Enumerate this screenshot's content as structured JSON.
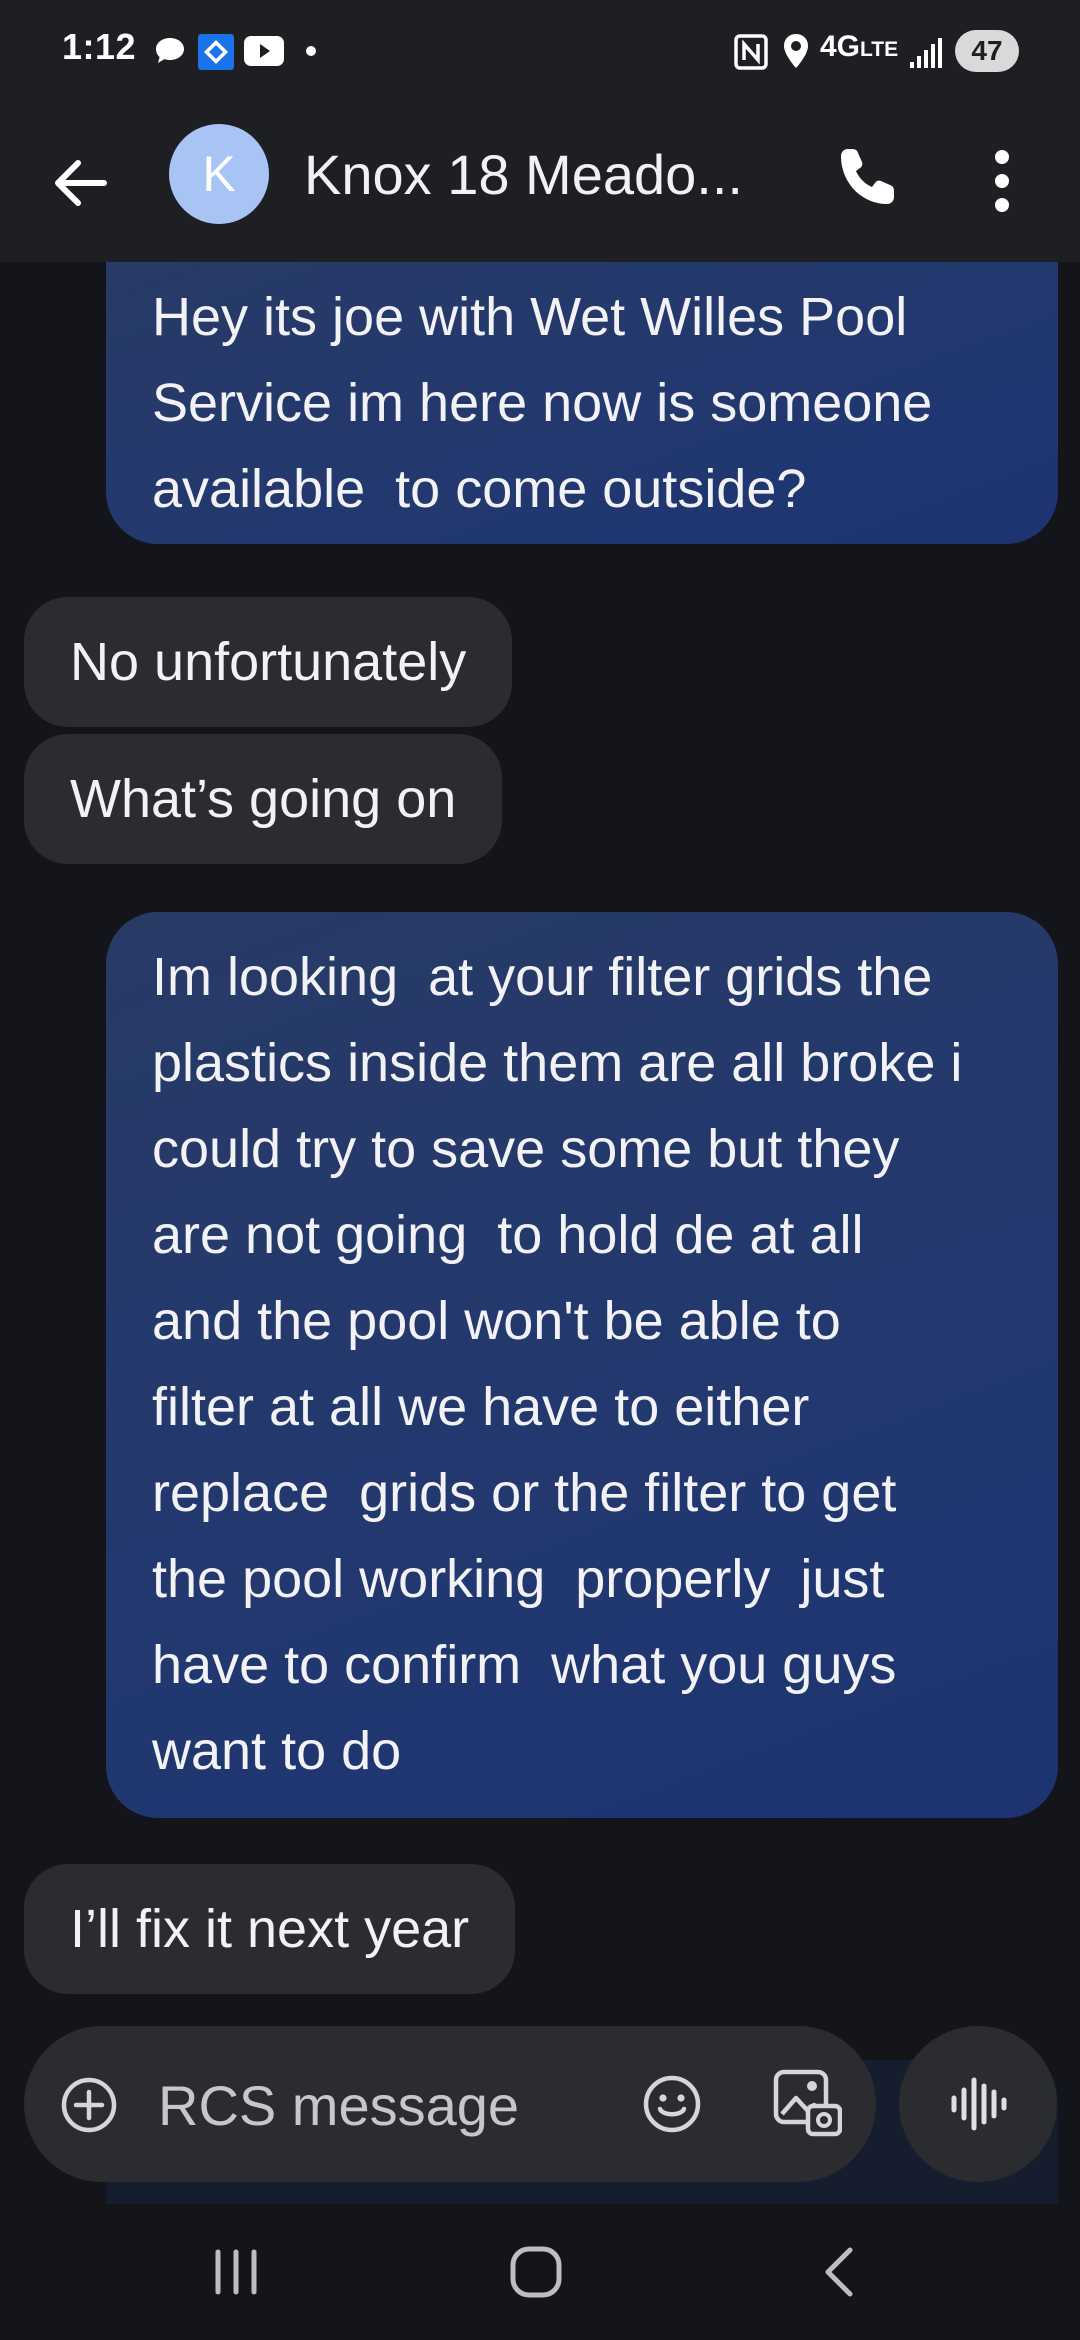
{
  "status_bar": {
    "time": "1:12",
    "network": "4G",
    "network_sub": "LTE",
    "battery": "47"
  },
  "header": {
    "avatar_letter": "K",
    "contact_name": "Knox 18 Meado..."
  },
  "messages": [
    {
      "direction": "outgoing",
      "lines": [
        "Hey its joe with Wet Willes Pool",
        "Service im here now is someone",
        "available  to come outside?"
      ]
    },
    {
      "direction": "incoming",
      "lines": [
        "No unfortunately"
      ]
    },
    {
      "direction": "incoming",
      "lines": [
        "What’s going on"
      ]
    },
    {
      "direction": "outgoing",
      "lines": [
        "Im looking  at your filter grids the",
        "plastics inside them are all broke i",
        "could try to save some but they",
        "are not going  to hold de at all",
        "and the pool won't be able to",
        "filter at all we have to either",
        "replace  grids or the filter to get",
        "the pool working  properly  just",
        "have to confirm  what you guys",
        "want to do"
      ]
    },
    {
      "direction": "incoming",
      "lines": [
        "I’ll fix it next year"
      ]
    }
  ],
  "composer": {
    "placeholder": "RCS message"
  },
  "colors": {
    "background": "#13151b",
    "bar": "#1d1f23",
    "incoming_bubble": "#2b2c30",
    "outgoing_bubble": "#22386e",
    "avatar": "#a8c4f5"
  },
  "icons": [
    "back-arrow-icon",
    "phone-icon",
    "more-vert-icon",
    "add-circle-icon",
    "emoji-icon",
    "gallery-icon",
    "voice-waveform-icon",
    "recents-icon",
    "home-icon",
    "nav-back-icon"
  ]
}
